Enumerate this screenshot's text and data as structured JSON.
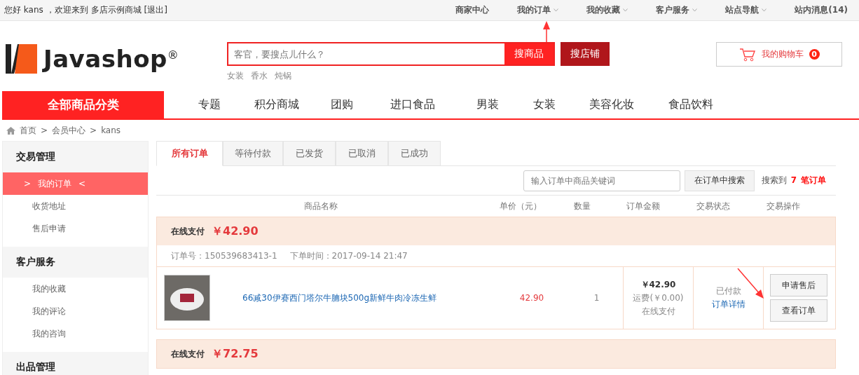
{
  "top_bar": {
    "greeting": "您好 kans ，欢迎来到",
    "shop_name": "多店示例商城",
    "logout": "[退出]",
    "links": [
      {
        "label": "商家中心",
        "dropdown": false
      },
      {
        "label": "我的订单",
        "dropdown": true
      },
      {
        "label": "我的收藏",
        "dropdown": true
      },
      {
        "label": "客户服务",
        "dropdown": true
      },
      {
        "label": "站点导航",
        "dropdown": true
      },
      {
        "label": "站内消息(14)",
        "dropdown": false
      }
    ]
  },
  "header": {
    "logo": {
      "text": "Javashop",
      "mark": "®"
    },
    "search": {
      "placeholder": "客官，要搜点儿什么？",
      "buttons": [
        "搜商品",
        "搜店铺"
      ]
    },
    "hot_words": [
      "女装",
      "香水",
      "炖锅"
    ],
    "cart": {
      "label": "我的购物车",
      "count": "0"
    }
  },
  "nav": {
    "category": "全部商品分类",
    "items": [
      "专题",
      "积分商城",
      "团购",
      "进口食品",
      "男装",
      "女装",
      "美容化妆",
      "食品饮料"
    ]
  },
  "breadcrumb": {
    "items": [
      "首页",
      "会员中心",
      "kans"
    ],
    "separator": ">"
  },
  "sidebar": [
    {
      "title": "交易管理",
      "items": [
        {
          "label": "我的订单",
          "selected": true,
          "prefix": ">",
          "suffix": "<"
        },
        {
          "label": "收货地址",
          "selected": false
        },
        {
          "label": "售后申请",
          "selected": false
        }
      ]
    },
    {
      "title": "客户服务",
      "items": [
        {
          "label": "我的收藏",
          "selected": false
        },
        {
          "label": "我的评论",
          "selected": false
        },
        {
          "label": "我的咨询",
          "selected": false
        }
      ]
    },
    {
      "title": "出品管理"
    }
  ],
  "tabs": [
    {
      "label": "所有订单",
      "selected": true
    },
    {
      "label": "等待付款",
      "selected": false
    },
    {
      "label": "已发货",
      "selected": false
    },
    {
      "label": "已取消",
      "selected": false
    },
    {
      "label": "已成功",
      "selected": false
    }
  ],
  "order_search": {
    "placeholder": "输入订单中商品关键词",
    "button": "在订单中搜索",
    "result_prefix": "搜索到",
    "result_count": "7",
    "result_suffix": "笔订单"
  },
  "columns": [
    "商品名称",
    "单价（元）",
    "数量",
    "订单金额",
    "交易状态",
    "交易操作"
  ],
  "orders": [
    {
      "payment": "在线支付",
      "total": "￥42.90",
      "order_no": "订单号：150539683413-1",
      "time": "下单时间：2017-09-14 21:47",
      "product": {
        "name": "66减30伊赛西门塔尔牛腩块500g新鲜牛肉冷冻生鲜",
        "price": "42.90",
        "quantity": "1"
      },
      "amount": "￥42.90",
      "shipping": "运费(￥0.00)",
      "pay_method": "在线支付",
      "status": "已付款",
      "detail_link": "订单详情",
      "actions": [
        "申请售后",
        "查看订单"
      ]
    },
    {
      "payment": "在线支付",
      "total": "￥72.75"
    }
  ]
}
